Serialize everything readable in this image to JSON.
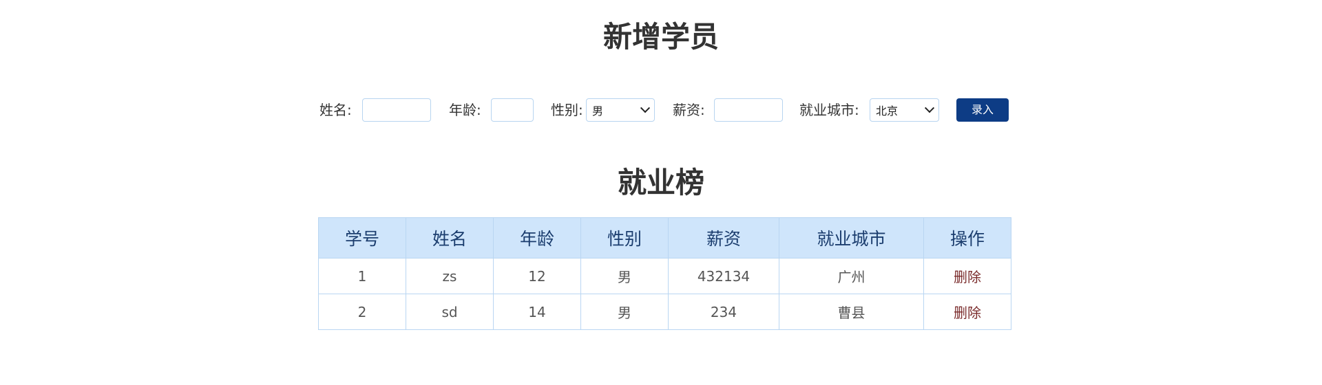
{
  "header": {
    "add_title": "新增学员",
    "board_title": "就业榜"
  },
  "form": {
    "name_label": "姓名:",
    "name_value": "",
    "age_label": "年龄:",
    "age_value": "",
    "gender_label": "性别:",
    "gender_selected": "男",
    "salary_label": "薪资:",
    "salary_value": "",
    "city_label": "就业城市:",
    "city_selected": "北京",
    "submit_label": "录入"
  },
  "table": {
    "headers": [
      "学号",
      "姓名",
      "年龄",
      "性别",
      "薪资",
      "就业城市",
      "操作"
    ],
    "rows": [
      [
        "1",
        "zs",
        "12",
        "男",
        "432134",
        "广州",
        "删除"
      ],
      [
        "2",
        "sd",
        "14",
        "男",
        "234",
        "曹县",
        "删除"
      ]
    ]
  },
  "colors": {
    "accent": "#0d3c85",
    "header_bg": "#cfe5fb",
    "border": "#b9d6f2",
    "delete_link": "#7a2b2b"
  }
}
